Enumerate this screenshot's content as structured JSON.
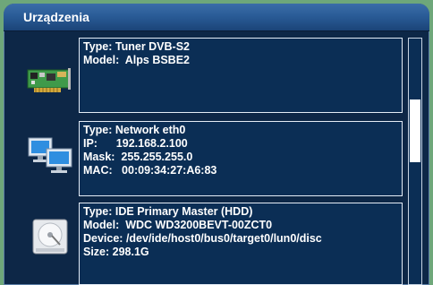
{
  "window": {
    "title": "Urządzenia"
  },
  "devices": [
    {
      "icon": "pci-card-icon",
      "lines": [
        "Type: Tuner DVB-S2",
        "Model:  Alps BSBE2"
      ]
    },
    {
      "icon": "network-computers-icon",
      "lines": [
        "Type: Network eth0",
        "IP:      192.168.2.100",
        "Mask:  255.255.255.0",
        "MAC:   00:09:34:27:A6:83"
      ]
    },
    {
      "icon": "hard-disk-icon",
      "lines": [
        "Type: IDE Primary Master (HDD)",
        "Model:  WDC WD3200BEVT-00ZCT0",
        "Device: /dev/ide/host0/bus0/target0/lun0/disc",
        "Size: 298.1G"
      ]
    }
  ],
  "colors": {
    "background": "#0d2747",
    "panel": "#0b2e55",
    "accent": "#2a5c97"
  }
}
